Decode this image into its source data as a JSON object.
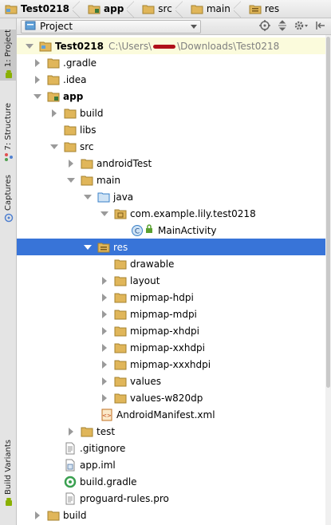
{
  "breadcrumb": [
    {
      "label": "Test0218",
      "icon": "project-folder-icon"
    },
    {
      "label": "app",
      "icon": "module-folder-icon"
    },
    {
      "label": "src",
      "icon": "folder-icon"
    },
    {
      "label": "main",
      "icon": "folder-icon"
    },
    {
      "label": "res",
      "icon": "resource-folder-icon"
    }
  ],
  "tool_strip": {
    "project_tab": "1: Project",
    "structure_tab": "7: Structure",
    "captures_tab": "Captures",
    "build_variants_tab": "Build Variants"
  },
  "panel": {
    "view_selector": "Project",
    "icons": [
      "sync-icon",
      "collapse-icon",
      "settings-icon",
      "hide-icon"
    ]
  },
  "tree": {
    "root_label": "Test0218",
    "root_path_prefix": "C:\\Users\\",
    "root_path_suffix": "\\Downloads\\Test0218",
    "rows": [
      {
        "label": "Test0218"
      },
      {
        "label": ".gradle"
      },
      {
        "label": ".idea"
      },
      {
        "label": "app"
      },
      {
        "label": "build"
      },
      {
        "label": "libs"
      },
      {
        "label": "src"
      },
      {
        "label": "androidTest"
      },
      {
        "label": "main"
      },
      {
        "label": "java"
      },
      {
        "label": "com.example.lily.test0218"
      },
      {
        "label": "MainActivity"
      },
      {
        "label": "res"
      },
      {
        "label": "drawable"
      },
      {
        "label": "layout"
      },
      {
        "label": "mipmap-hdpi"
      },
      {
        "label": "mipmap-mdpi"
      },
      {
        "label": "mipmap-xhdpi"
      },
      {
        "label": "mipmap-xxhdpi"
      },
      {
        "label": "mipmap-xxxhdpi"
      },
      {
        "label": "values"
      },
      {
        "label": "values-w820dp"
      },
      {
        "label": "AndroidManifest.xml"
      },
      {
        "label": "test"
      },
      {
        "label": ".gitignore"
      },
      {
        "label": "app.iml"
      },
      {
        "label": "build.gradle"
      },
      {
        "label": "proguard-rules.pro"
      },
      {
        "label": "build"
      }
    ]
  },
  "colors": {
    "selection": "#3874d8",
    "folder": "#e0b65a",
    "source_folder": "#5fa0d8",
    "class_icon": "#5fa0d8"
  }
}
